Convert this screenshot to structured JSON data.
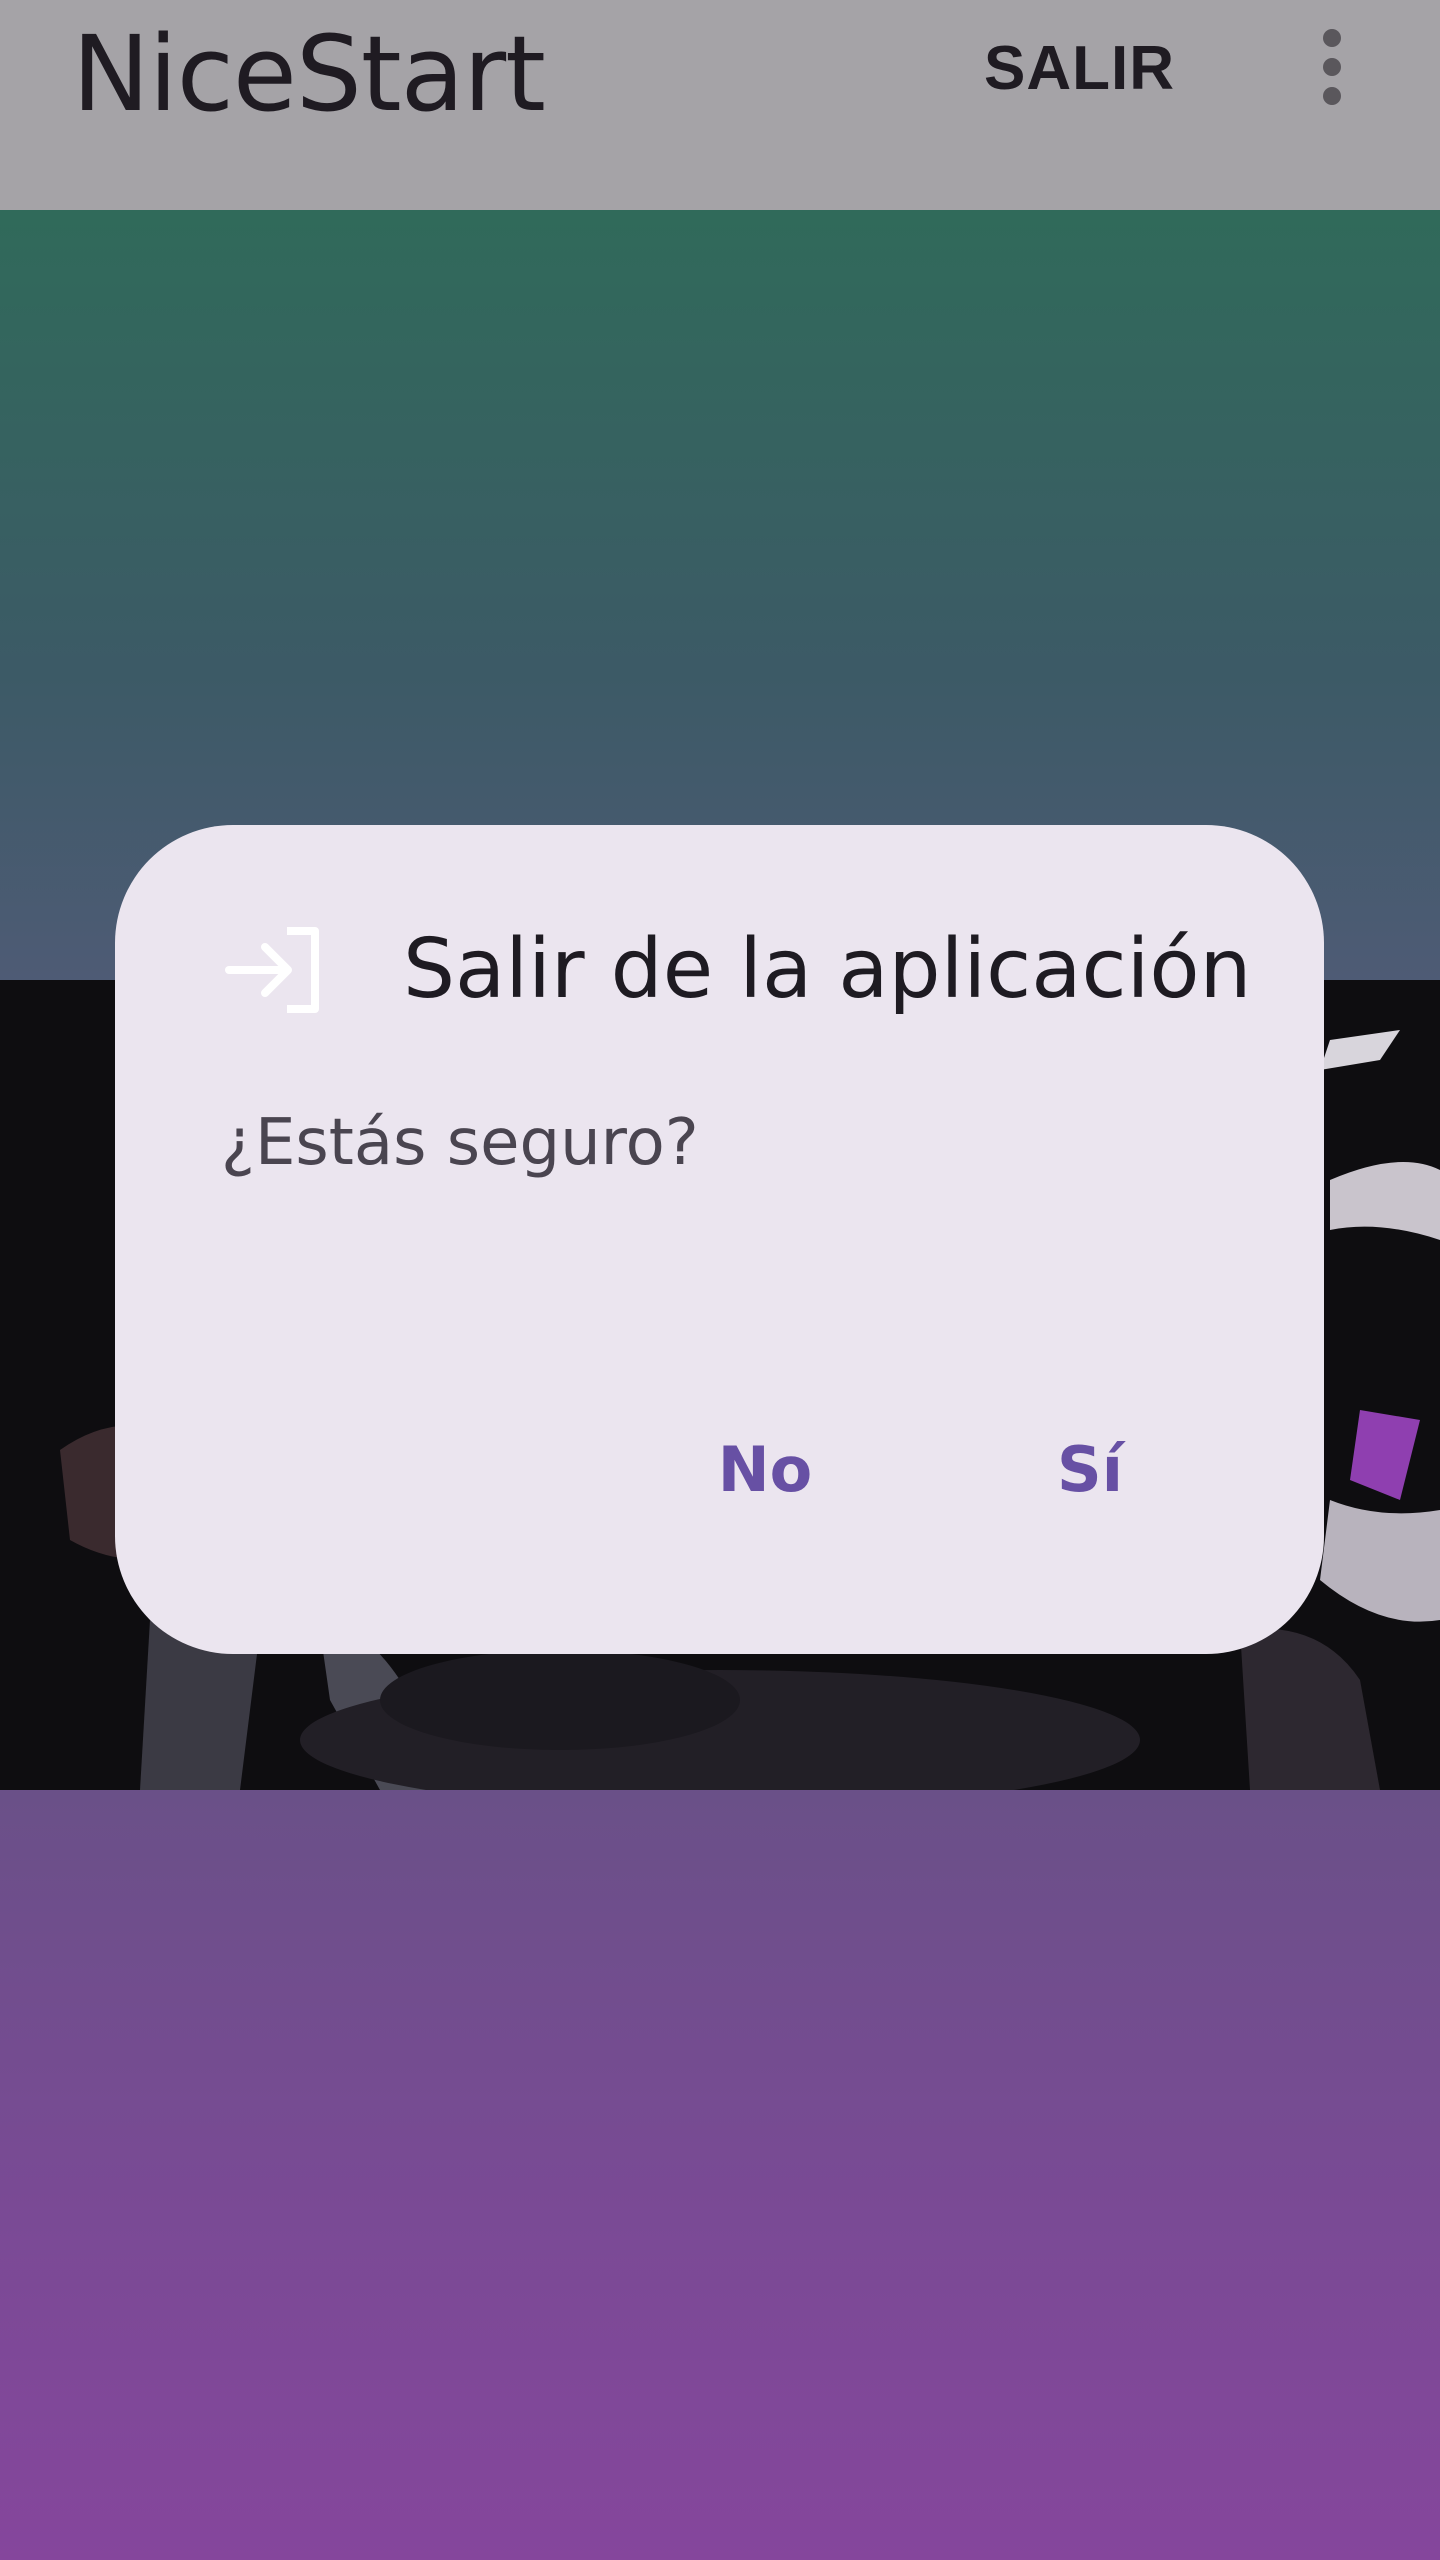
{
  "app_bar": {
    "title": "NiceStart",
    "action_label": "SALIR",
    "overflow_icon": "more-vert-icon"
  },
  "content": {
    "top_gradient_colors": [
      "#306a5a",
      "#4e5b75"
    ],
    "bottom_gradient_colors": [
      "#6a5088",
      "#85469c"
    ],
    "media": "anime-video-frame"
  },
  "dialog": {
    "icon": "login-icon",
    "title": "Salir de la aplicación",
    "message": "¿Estás seguro?",
    "negative_label": "No",
    "positive_label": "Sí",
    "accent_color": "#6750a4"
  }
}
